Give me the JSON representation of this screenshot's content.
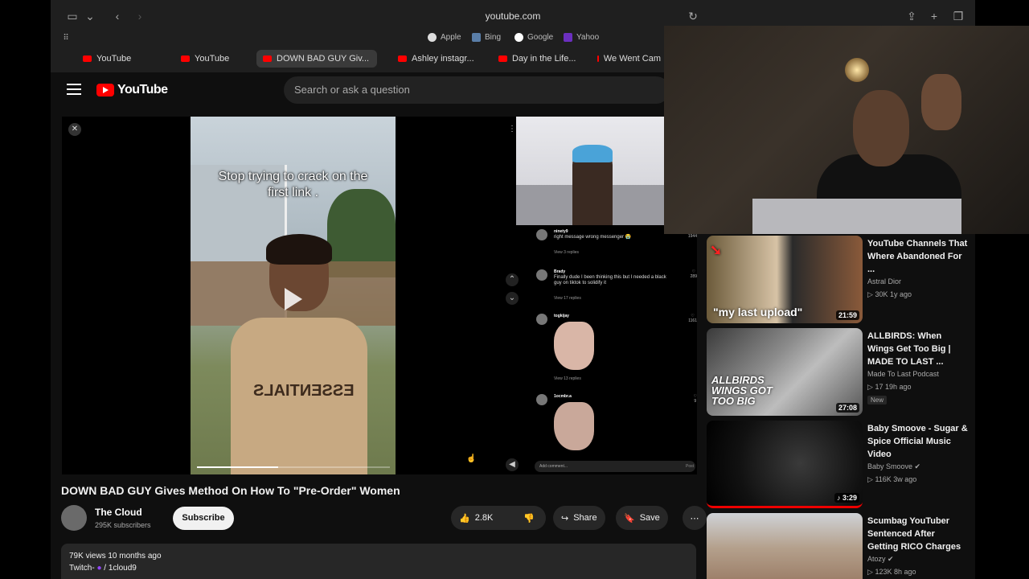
{
  "browser": {
    "url": "youtube.com",
    "favorites": [
      "Apple",
      "Bing",
      "Google",
      "Yahoo"
    ],
    "tabs": [
      "YouTube",
      "YouTube",
      "DOWN BAD GUY Giv...",
      "Ashley instagr...",
      "Day in the Life...",
      "We Went Cam"
    ]
  },
  "masthead": {
    "logo": "YouTube",
    "search_placeholder": "Search or ask a question"
  },
  "player": {
    "caption_line1": "Stop trying to crack on the",
    "caption_line2": "first link .",
    "shirt_text": "ESSENTIALS",
    "progress": 0.42,
    "comments": [
      {
        "name": "ninety9",
        "text": "right message wrong messenger 😭",
        "likes": "1944",
        "replies": "View 3 replies"
      },
      {
        "name": "Brady",
        "text": "Finally dude I been thinking this but I needed a black guy on tiktok to solidify it",
        "likes": "289",
        "replies": "View 17 replies"
      },
      {
        "name": "togkijay",
        "text": "",
        "likes": "1161",
        "replies": "View 13 replies"
      },
      {
        "name": "1ocmbr.a",
        "text": "",
        "likes": "9",
        "replies": ""
      }
    ],
    "add_comment": "Add comment...",
    "post": "Post"
  },
  "video": {
    "title": "DOWN BAD GUY Gives Method On How To \"Pre-Order\" Women",
    "channel": "The Cloud",
    "subscribers": "295K subscribers",
    "subscribe_label": "Subscribe",
    "likes": "2.8K",
    "share_label": "Share",
    "save_label": "Save",
    "views_date": "79K views  10 months ago",
    "twitch_prefix": "Twitch-",
    "twitch_handle": "/ 1cloud9"
  },
  "recommendations": [
    {
      "title": "YouTube Channels That Where Abandoned For ...",
      "channel": "Astral Dior",
      "meta": "30K  1y ago",
      "duration": "21:59",
      "thumb_text": "\"my last upload\"",
      "new": false
    },
    {
      "title": "ALLBIRDS: When Wings Get Too Big | MADE TO LAST ...",
      "channel": "Made To Last Podcast",
      "meta": "17  19h ago",
      "duration": "27:08",
      "thumb_text": "ALLBIRDS WINGS GOT TOO BIG",
      "new_label": "New",
      "new": true
    },
    {
      "title": "Baby Smoove - Sugar & Spice  Official Music Video",
      "channel": "Baby Smoove",
      "meta": "116K  3w ago",
      "duration": "3:29",
      "thumb_text": "",
      "new": false
    },
    {
      "title": "Scumbag YouTuber Sentenced After Getting RICO Charges",
      "channel": "Atozy",
      "meta": "123K  8h ago",
      "duration": "",
      "thumb_text": "",
      "new": false
    }
  ]
}
